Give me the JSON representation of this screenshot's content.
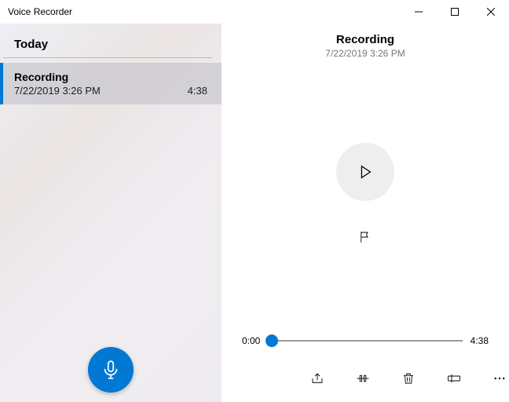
{
  "app": {
    "title": "Voice Recorder"
  },
  "sidebar": {
    "section_label": "Today",
    "items": [
      {
        "title": "Recording",
        "date": "7/22/2019 3:26 PM",
        "duration": "4:38"
      }
    ]
  },
  "detail": {
    "title": "Recording",
    "date": "7/22/2019 3:26 PM",
    "current_time": "0:00",
    "total_time": "4:38"
  },
  "icons": {
    "minimize": "minimize",
    "maximize": "maximize",
    "close": "close",
    "microphone": "microphone",
    "play": "play",
    "flag": "flag",
    "share": "share",
    "trim": "trim",
    "delete": "delete",
    "rename": "rename",
    "more": "more"
  },
  "colors": {
    "accent": "#0078d4"
  }
}
